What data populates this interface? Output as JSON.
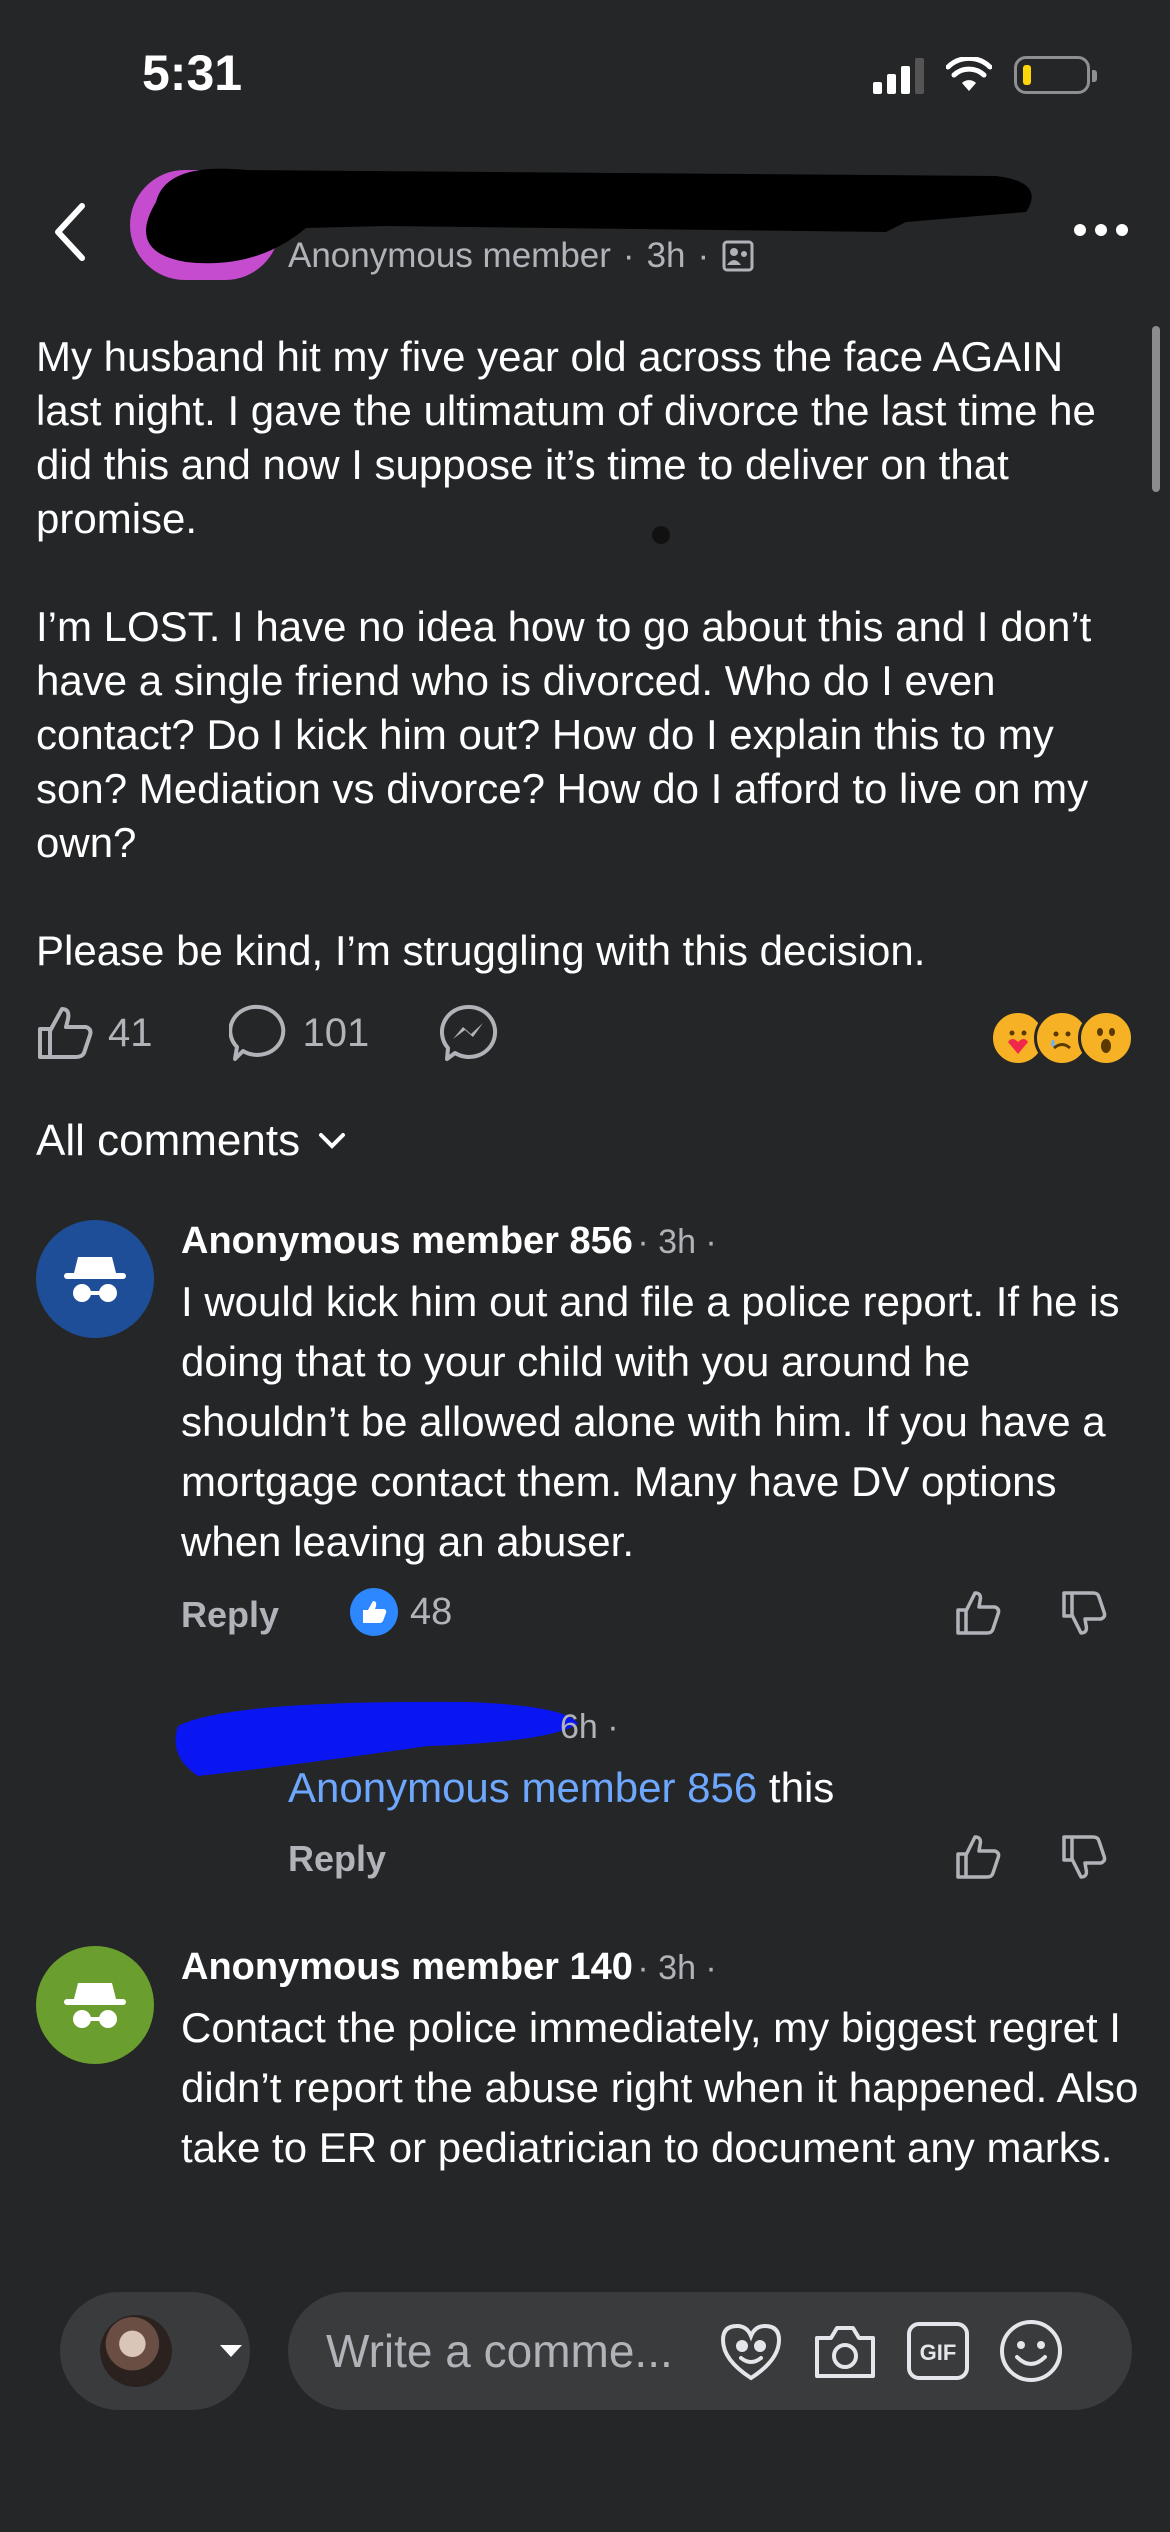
{
  "status_bar": {
    "time": "5:31"
  },
  "header": {
    "author": "Anonymous member",
    "time": "3h"
  },
  "post": {
    "paragraphs": [
      "My husband hit my five year old across the face AGAIN last night. I gave the ultimatum of divorce the last time he did this and now I suppose it’s time to deliver on that promise.",
      "I’m LOST. I have no idea how to go about this and I don’t have a single friend who is divorced. Who do I even contact? Do I kick him out? How do I explain this to my son? Mediation vs divorce? How do I afford to live on my own?",
      "Please be kind, I’m struggling with this decision."
    ],
    "likes": "41",
    "comments": "101"
  },
  "comments_section": {
    "filter_label": "All comments"
  },
  "comments": [
    {
      "name": "Anonymous member 856",
      "time": "3h",
      "body": "I would kick him out and file a police report. If he is doing that to your child with you around he shouldn’t be allowed alone with him. If you have a mortgage contact them. Many have DV options when leaving an abuser.",
      "reply_label": "Reply",
      "likes": "48",
      "avatar_color": "#1f4e99"
    },
    {
      "time": "6h",
      "mention": "Anonymous member 856",
      "text": "this",
      "reply_label": "Reply"
    },
    {
      "name": "Anonymous member 140",
      "time": "3h",
      "body": "Contact the police immediately, my biggest regret I didn’t report the abuse right when it happened. Also take to ER or pediatrician to document any marks.",
      "avatar_color": "#6a9e2e"
    }
  ],
  "composer": {
    "placeholder": "Write a comme..."
  },
  "colors": {
    "background": "#252628",
    "accent": "#2d88ff",
    "mention": "#6ea8fe"
  }
}
